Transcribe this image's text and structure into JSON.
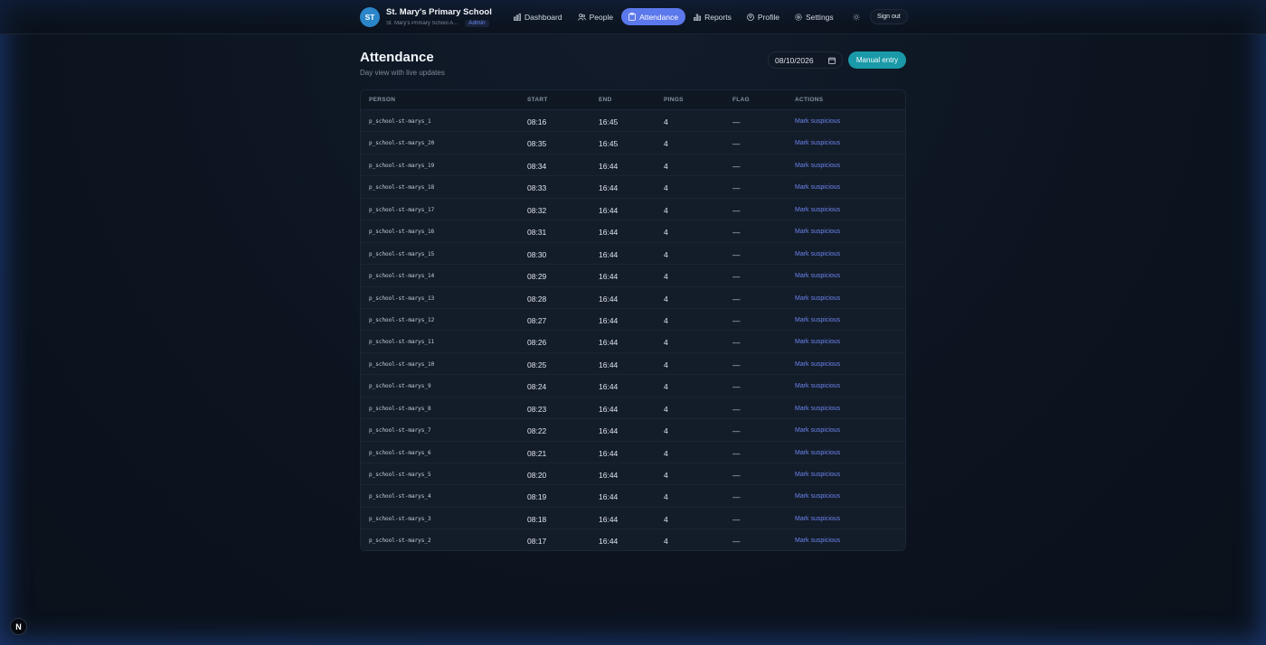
{
  "brand": {
    "initials": "ST",
    "name": "St. Mary's Primary School",
    "subtitle": "St. Mary's Primary School A...",
    "role": "Admin"
  },
  "nav": [
    {
      "key": "dashboard",
      "label": "Dashboard",
      "icon": "chart-icon",
      "active": false
    },
    {
      "key": "people",
      "label": "People",
      "icon": "people-icon",
      "active": false
    },
    {
      "key": "attendance",
      "label": "Attendance",
      "icon": "clipboard-icon",
      "active": true
    },
    {
      "key": "reports",
      "label": "Reports",
      "icon": "bar-chart-icon",
      "active": false
    },
    {
      "key": "profile",
      "label": "Profile",
      "icon": "user-circle-icon",
      "active": false
    },
    {
      "key": "settings",
      "label": "Settings",
      "icon": "gear-icon",
      "active": false
    }
  ],
  "header": {
    "theme_icon": "sun-icon",
    "signout_label": "Sign out"
  },
  "page": {
    "title": "Attendance",
    "subtitle": "Day view with live updates",
    "date_value": "08/10/2026",
    "manual_entry_label": "Manual entry"
  },
  "table": {
    "columns": [
      "PERSON",
      "START",
      "END",
      "PINGS",
      "FLAG",
      "ACTIONS"
    ],
    "rows": [
      {
        "person": "p_school-st-marys_1",
        "start": "08:16",
        "end": "16:45",
        "pings": "4",
        "flag": "—",
        "action": "Mark suspicious"
      },
      {
        "person": "p_school-st-marys_20",
        "start": "08:35",
        "end": "16:45",
        "pings": "4",
        "flag": "—",
        "action": "Mark suspicious"
      },
      {
        "person": "p_school-st-marys_19",
        "start": "08:34",
        "end": "16:44",
        "pings": "4",
        "flag": "—",
        "action": "Mark suspicious"
      },
      {
        "person": "p_school-st-marys_18",
        "start": "08:33",
        "end": "16:44",
        "pings": "4",
        "flag": "—",
        "action": "Mark suspicious"
      },
      {
        "person": "p_school-st-marys_17",
        "start": "08:32",
        "end": "16:44",
        "pings": "4",
        "flag": "—",
        "action": "Mark suspicious"
      },
      {
        "person": "p_school-st-marys_16",
        "start": "08:31",
        "end": "16:44",
        "pings": "4",
        "flag": "—",
        "action": "Mark suspicious"
      },
      {
        "person": "p_school-st-marys_15",
        "start": "08:30",
        "end": "16:44",
        "pings": "4",
        "flag": "—",
        "action": "Mark suspicious"
      },
      {
        "person": "p_school-st-marys_14",
        "start": "08:29",
        "end": "16:44",
        "pings": "4",
        "flag": "—",
        "action": "Mark suspicious"
      },
      {
        "person": "p_school-st-marys_13",
        "start": "08:28",
        "end": "16:44",
        "pings": "4",
        "flag": "—",
        "action": "Mark suspicious"
      },
      {
        "person": "p_school-st-marys_12",
        "start": "08:27",
        "end": "16:44",
        "pings": "4",
        "flag": "—",
        "action": "Mark suspicious"
      },
      {
        "person": "p_school-st-marys_11",
        "start": "08:26",
        "end": "16:44",
        "pings": "4",
        "flag": "—",
        "action": "Mark suspicious"
      },
      {
        "person": "p_school-st-marys_10",
        "start": "08:25",
        "end": "16:44",
        "pings": "4",
        "flag": "—",
        "action": "Mark suspicious"
      },
      {
        "person": "p_school-st-marys_9",
        "start": "08:24",
        "end": "16:44",
        "pings": "4",
        "flag": "—",
        "action": "Mark suspicious"
      },
      {
        "person": "p_school-st-marys_8",
        "start": "08:23",
        "end": "16:44",
        "pings": "4",
        "flag": "—",
        "action": "Mark suspicious"
      },
      {
        "person": "p_school-st-marys_7",
        "start": "08:22",
        "end": "16:44",
        "pings": "4",
        "flag": "—",
        "action": "Mark suspicious"
      },
      {
        "person": "p_school-st-marys_6",
        "start": "08:21",
        "end": "16:44",
        "pings": "4",
        "flag": "—",
        "action": "Mark suspicious"
      },
      {
        "person": "p_school-st-marys_5",
        "start": "08:20",
        "end": "16:44",
        "pings": "4",
        "flag": "—",
        "action": "Mark suspicious"
      },
      {
        "person": "p_school-st-marys_4",
        "start": "08:19",
        "end": "16:44",
        "pings": "4",
        "flag": "—",
        "action": "Mark suspicious"
      },
      {
        "person": "p_school-st-marys_3",
        "start": "08:18",
        "end": "16:44",
        "pings": "4",
        "flag": "—",
        "action": "Mark suspicious"
      },
      {
        "person": "p_school-st-marys_2",
        "start": "08:17",
        "end": "16:44",
        "pings": "4",
        "flag": "—",
        "action": "Mark suspicious"
      }
    ]
  },
  "dev_badge": {
    "label": "N",
    "icon": "next-logo-icon"
  },
  "colors": {
    "accent": "#5b78ec",
    "primary_button": "#1a9aa8",
    "link": "#6b85ee",
    "avatar": "#2a86c9"
  }
}
